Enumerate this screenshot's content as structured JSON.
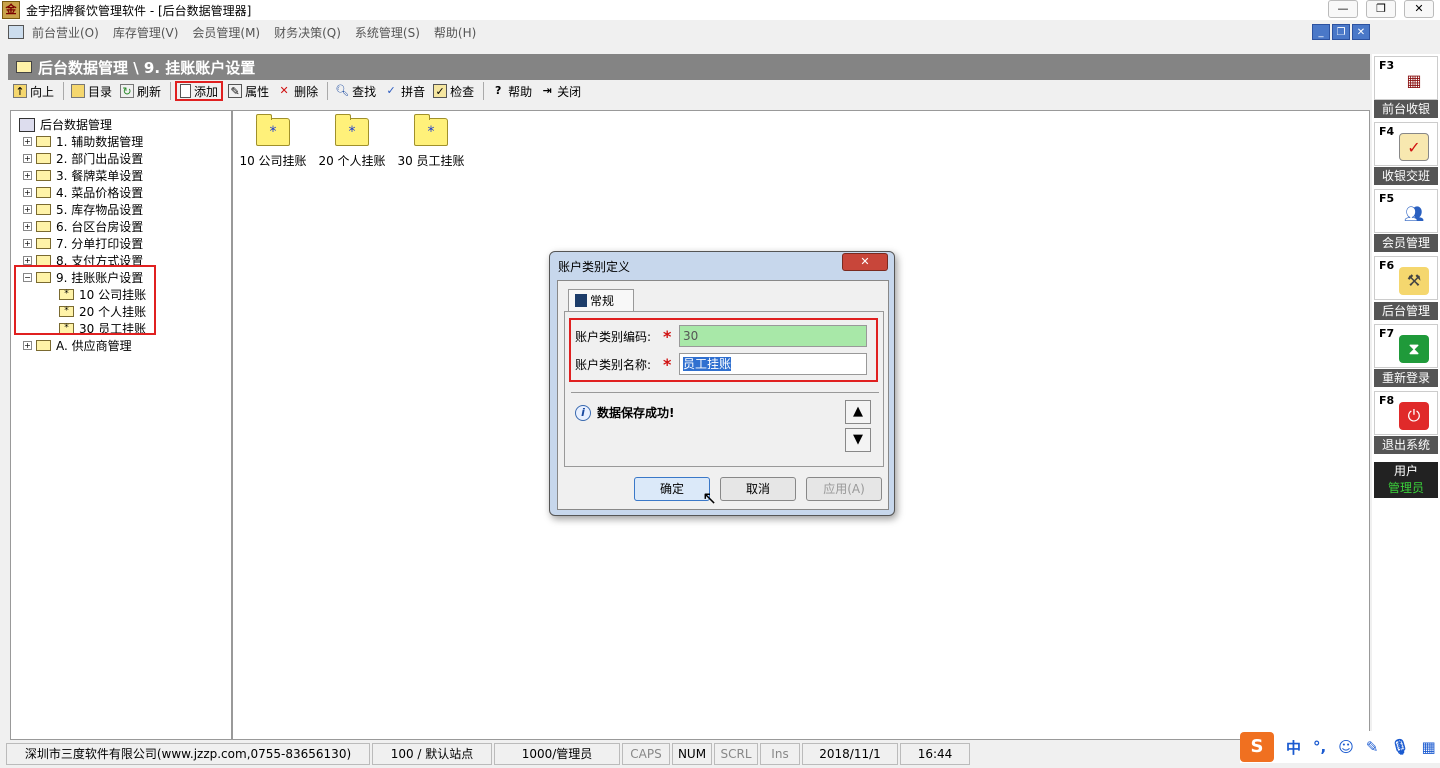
{
  "window": {
    "title": "金宇招牌餐饮管理软件 - [后台数据管理器]",
    "app_icon_text": "金",
    "buttons": [
      "—",
      "❐",
      "✕"
    ]
  },
  "menu": {
    "items": [
      "前台营业(O)",
      "库存管理(V)",
      "会员管理(M)",
      "财务决策(Q)",
      "系统管理(S)",
      "帮助(H)"
    ],
    "mdi_buttons": [
      "_",
      "❐",
      "✕"
    ]
  },
  "header": {
    "title": "后台数据管理 \\ 9. 挂账账户设置"
  },
  "toolbar": {
    "up": "向上",
    "dir": "目录",
    "refresh": "刷新",
    "add": "添加",
    "props": "属性",
    "delete": "删除",
    "find": "查找",
    "pinyin": "拼音",
    "check": "检查",
    "help": "帮助",
    "close": "关闭"
  },
  "tree": {
    "root": "后台数据管理",
    "items": [
      "1. 辅助数据管理",
      "2. 部门出品设置",
      "3. 餐牌菜单设置",
      "4. 菜品价格设置",
      "5. 库存物品设置",
      "6. 台区台房设置",
      "7. 分单打印设置",
      "8. 支付方式设置",
      "9. 挂账账户设置"
    ],
    "children": [
      "10 公司挂账",
      "20 个人挂账",
      "30 员工挂账"
    ],
    "last": "A. 供应商管理"
  },
  "content": {
    "folders": [
      "10 公司挂账",
      "20 个人挂账",
      "30 员工挂账"
    ]
  },
  "sidebar": {
    "buttons": [
      {
        "key": "F3",
        "label": "前台收银",
        "icon": "cash-register-icon"
      },
      {
        "key": "F4",
        "label": "收银交班",
        "icon": "clipboard-check-icon"
      },
      {
        "key": "F5",
        "label": "会员管理",
        "icon": "users-icon"
      },
      {
        "key": "F6",
        "label": "后台管理",
        "icon": "tools-icon"
      },
      {
        "key": "F7",
        "label": "重新登录",
        "icon": "hourglass-icon"
      },
      {
        "key": "F8",
        "label": "退出系统",
        "icon": "power-icon"
      }
    ],
    "user_title": "用户",
    "user_name": "管理员"
  },
  "statusbar": {
    "company": "深圳市三度软件有限公司(www.jzzp.com,0755-83656130)",
    "station": "100 / 默认站点",
    "operator": "1000/管理员",
    "caps": "CAPS",
    "num": "NUM",
    "scrl": "SCRL",
    "ins": "Ins",
    "date": "2018/11/1",
    "time": "16:44"
  },
  "ime": {
    "logo": "S",
    "mode": "中"
  },
  "dialog": {
    "title": "账户类别定义",
    "tab": "常规",
    "code_label": "账户类别编码:",
    "code_value": "30",
    "name_label": "账户类别名称:",
    "name_value": "员工挂账",
    "required_mark": "*",
    "message": "数据保存成功!",
    "ok": "确定",
    "cancel": "取消",
    "apply": "应用(A)"
  }
}
